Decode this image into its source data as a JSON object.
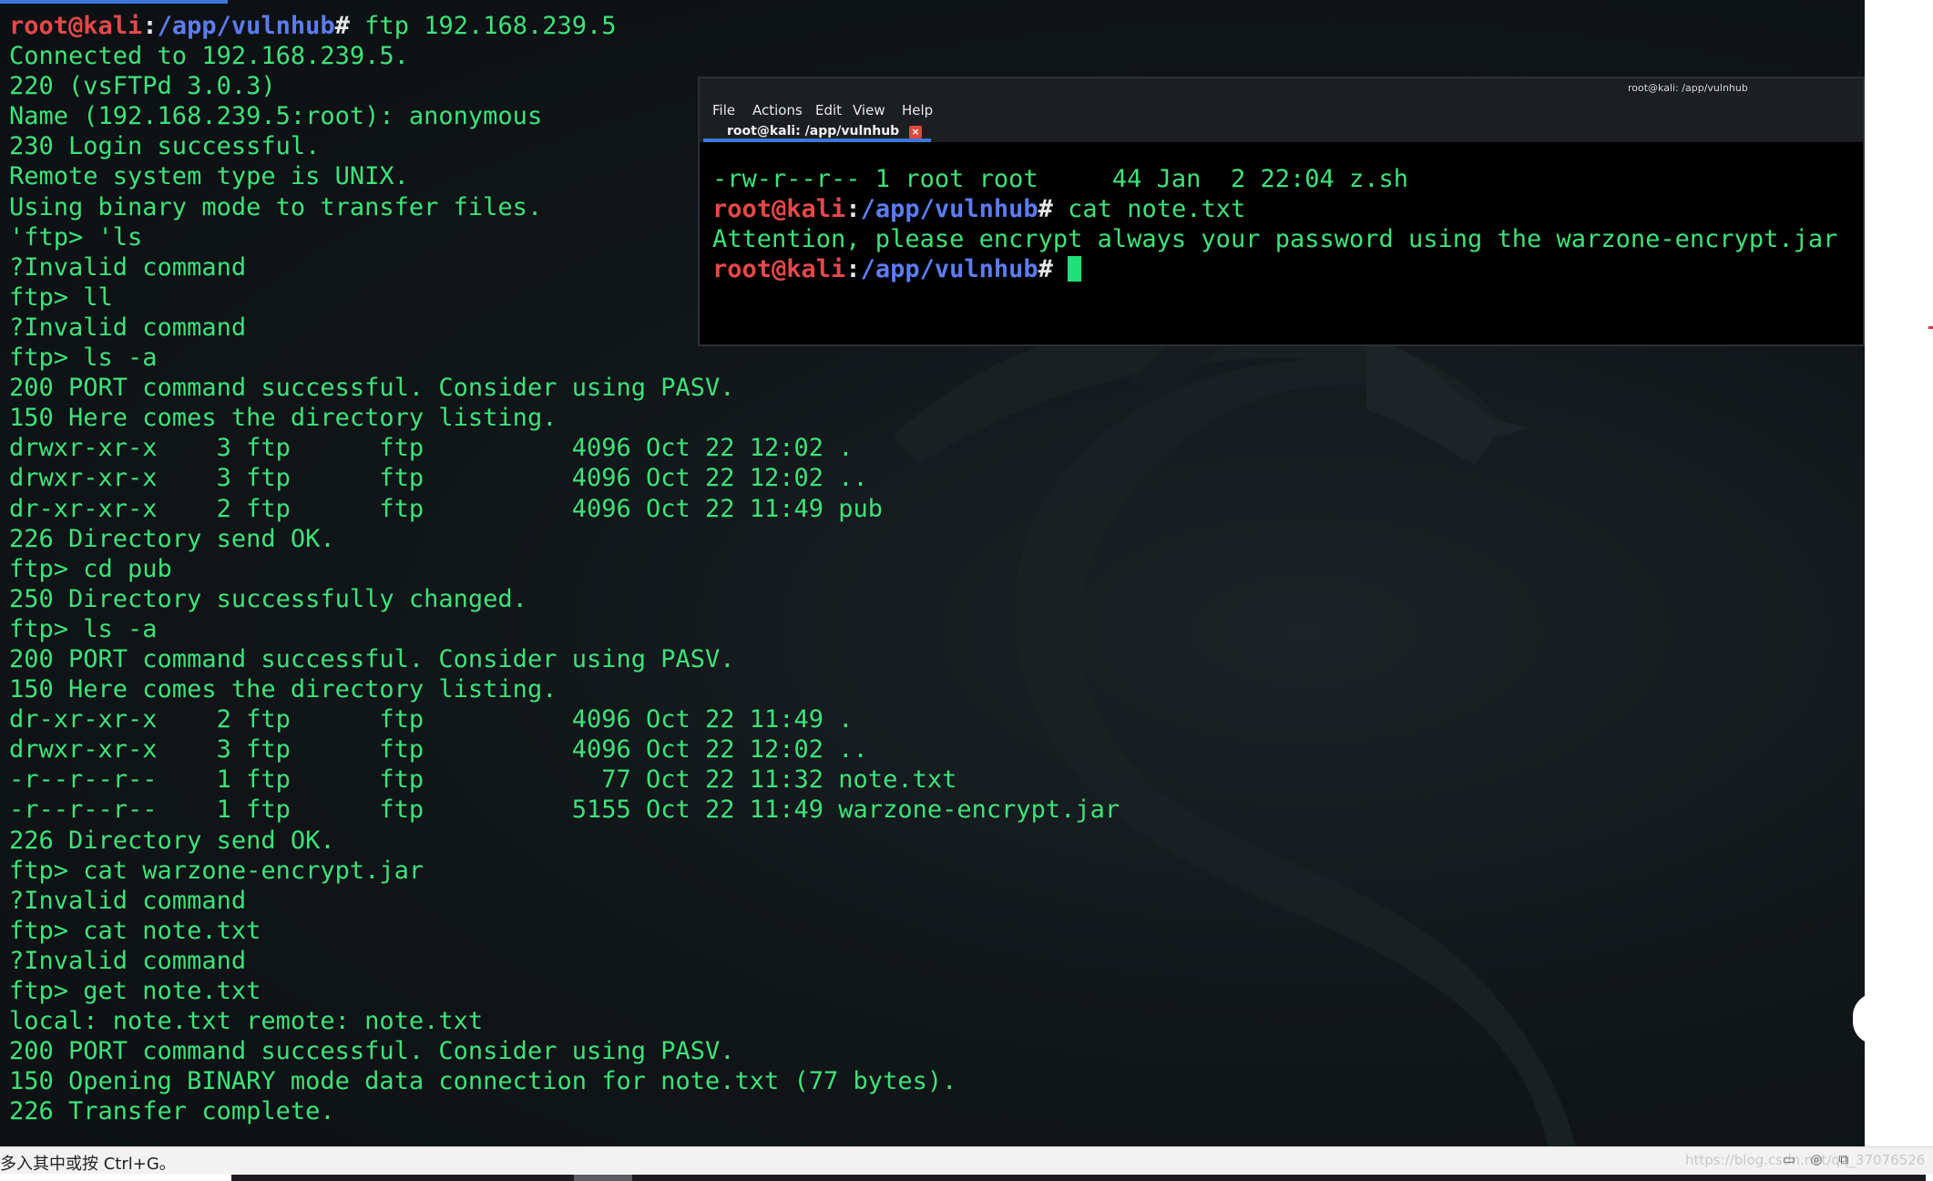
{
  "main_terminal": {
    "lines": [
      {
        "type": "prompt",
        "user": "root@kali",
        "sep": ":",
        "path": "/app/vulnhub",
        "hash": "#",
        "cmd": " ftp 192.168.239.5"
      },
      {
        "type": "out",
        "text": "Connected to 192.168.239.5."
      },
      {
        "type": "out",
        "text": "220 (vsFTPd 3.0.3)"
      },
      {
        "type": "out",
        "text": "Name (192.168.239.5:root): anonymous"
      },
      {
        "type": "out",
        "text": "230 Login successful."
      },
      {
        "type": "out",
        "text": "Remote system type is UNIX."
      },
      {
        "type": "out",
        "text": "Using binary mode to transfer files."
      },
      {
        "type": "out",
        "text": "'ftp> 'ls"
      },
      {
        "type": "out",
        "text": "?Invalid command"
      },
      {
        "type": "out",
        "text": "ftp> ll"
      },
      {
        "type": "out",
        "text": "?Invalid command"
      },
      {
        "type": "out",
        "text": "ftp> ls -a"
      },
      {
        "type": "out",
        "text": "200 PORT command successful. Consider using PASV."
      },
      {
        "type": "out",
        "text": "150 Here comes the directory listing."
      },
      {
        "type": "out",
        "text": "drwxr-xr-x    3 ftp      ftp          4096 Oct 22 12:02 ."
      },
      {
        "type": "out",
        "text": "drwxr-xr-x    3 ftp      ftp          4096 Oct 22 12:02 .."
      },
      {
        "type": "out",
        "text": "dr-xr-xr-x    2 ftp      ftp          4096 Oct 22 11:49 pub"
      },
      {
        "type": "out",
        "text": "226 Directory send OK."
      },
      {
        "type": "out",
        "text": "ftp> cd pub"
      },
      {
        "type": "out",
        "text": "250 Directory successfully changed."
      },
      {
        "type": "out",
        "text": "ftp> ls -a"
      },
      {
        "type": "out",
        "text": "200 PORT command successful. Consider using PASV."
      },
      {
        "type": "out",
        "text": "150 Here comes the directory listing."
      },
      {
        "type": "out",
        "text": "dr-xr-xr-x    2 ftp      ftp          4096 Oct 22 11:49 ."
      },
      {
        "type": "out",
        "text": "drwxr-xr-x    3 ftp      ftp          4096 Oct 22 12:02 .."
      },
      {
        "type": "out",
        "text": "-r--r--r--    1 ftp      ftp            77 Oct 22 11:32 note.txt"
      },
      {
        "type": "out",
        "text": "-r--r--r--    1 ftp      ftp          5155 Oct 22 11:49 warzone-encrypt.jar"
      },
      {
        "type": "out",
        "text": "226 Directory send OK."
      },
      {
        "type": "out",
        "text": "ftp> cat warzone-encrypt.jar"
      },
      {
        "type": "out",
        "text": "?Invalid command"
      },
      {
        "type": "out",
        "text": "ftp> cat note.txt"
      },
      {
        "type": "out",
        "text": "?Invalid command"
      },
      {
        "type": "out",
        "text": "ftp> get note.txt"
      },
      {
        "type": "out",
        "text": "local: note.txt remote: note.txt"
      },
      {
        "type": "out",
        "text": "200 PORT command successful. Consider using PASV."
      },
      {
        "type": "out",
        "text": "150 Opening BINARY mode data connection for note.txt (77 bytes)."
      },
      {
        "type": "out",
        "text": "226 Transfer complete."
      }
    ]
  },
  "second_terminal": {
    "title": "root@kali: /app/vulnhub",
    "menu": [
      "File",
      "Actions",
      "Edit",
      "View",
      "Help"
    ],
    "tab_label": "root@kali: /app/vulnhub",
    "tab_close": "×",
    "lines": [
      {
        "type": "out",
        "text": "-rw-r--r-- 1 root root     44 Jan  2 22:04 z.sh"
      },
      {
        "type": "prompt",
        "user": "root@kali",
        "sep": ":",
        "path": "/app/vulnhub",
        "hash": "#",
        "cmd": " cat note.txt"
      },
      {
        "type": "out",
        "text": "Attention, please encrypt always your password using the warzone-encrypt.jar"
      },
      {
        "type": "prompt",
        "user": "root@kali",
        "sep": ":",
        "path": "/app/vulnhub",
        "hash": "#",
        "cmd": " ",
        "cursor": true
      }
    ]
  },
  "status_bar": {
    "text": "多入其中或按 Ctrl+G。",
    "watermark": "https://blog.csdn.net/qq_37076526",
    "tray_icons": [
      "monitor-icon",
      "globe-icon",
      "network-icon"
    ]
  },
  "colors": {
    "prompt_user": "#e44848",
    "prompt_path": "#5d7cf0",
    "output": "#3ee27a",
    "cursor": "#1fe07a"
  }
}
